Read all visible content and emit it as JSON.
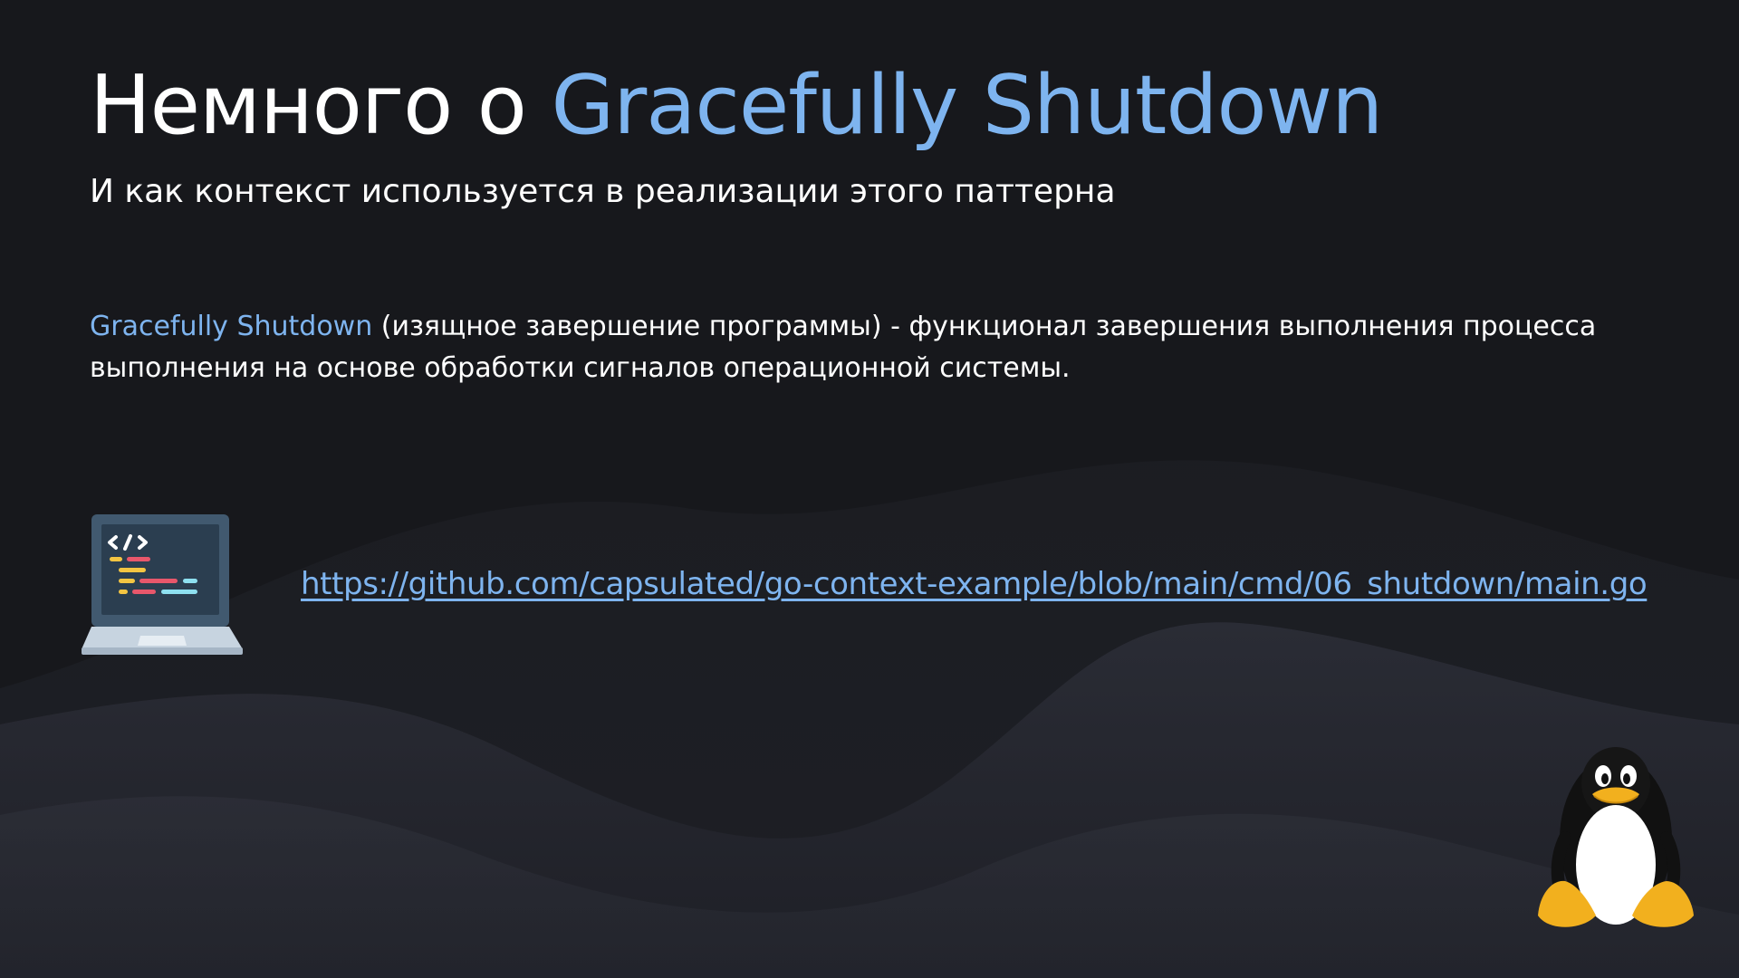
{
  "slide": {
    "title_plain": "Немного о ",
    "title_accent": "Gracefully Shutdown",
    "subtitle": "И как контекст используется в реализации этого паттерна",
    "definition": {
      "term": "Gracefully Shutdown",
      "text": " (изящное завершение программы) - функционал завершения выполнения процесса выполнения на основе обработки сигналов операционной системы."
    },
    "link": "https://github.com/capsulated/go-context-example/blob/main/cmd/06_shutdown/main.go",
    "icons": [
      "laptop-code-icon",
      "tux-penguin-icon"
    ]
  },
  "colors": {
    "background": "#17181c",
    "accent": "#7eb4ef",
    "text": "#ffffff"
  }
}
